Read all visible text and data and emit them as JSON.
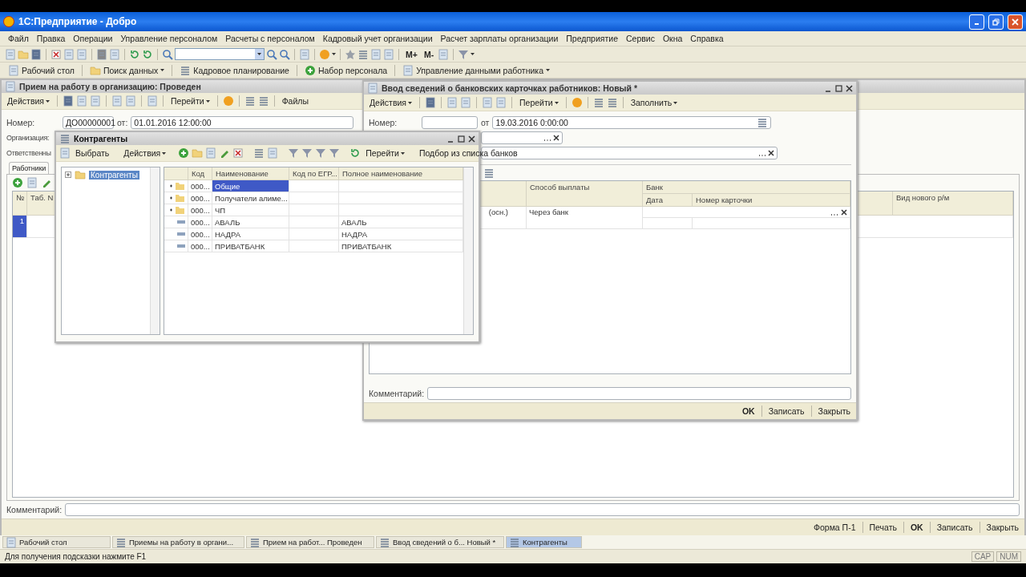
{
  "app": {
    "title": "1С:Предприятие - Добро"
  },
  "menu": [
    "Файл",
    "Правка",
    "Операции",
    "Управление персоналом",
    "Расчеты с персоналом",
    "Кадровый учет организации",
    "Расчет зарплаты организации",
    "Предприятие",
    "Сервис",
    "Окна",
    "Справка"
  ],
  "memory_buttons": [
    "M+",
    "M-"
  ],
  "quick_panel": [
    {
      "label": "Рабочий стол",
      "dropdown": false
    },
    {
      "label": "Поиск данных",
      "dropdown": true
    },
    {
      "label": "Кадровое планирование",
      "dropdown": false
    },
    {
      "label": "Набор персонала",
      "dropdown": false
    },
    {
      "label": "Управление данными работника",
      "dropdown": true
    }
  ],
  "hire_doc": {
    "title": "Прием на работу в организацию: Проведен",
    "toolbar": [
      {
        "label": "Действия",
        "dropdown": true
      },
      {
        "label": "Перейти",
        "dropdown": true
      },
      {
        "label": "Файлы",
        "dropdown": false
      }
    ],
    "number_label": "Номер:",
    "number": "ДО00000001",
    "date_label": "от:",
    "date": "01.01.2016 12:00:00",
    "labels": [
      "Организация:",
      "Ответственны"
    ],
    "tab": {
      "label": "Работники",
      "selected": true
    },
    "columns": [
      "№",
      "Таб. N"
    ],
    "last_column": "Вид нового р/м",
    "rows": [
      {
        "number": "1",
        "selected": true
      }
    ],
    "comment_label": "Комментарий:",
    "buttons": [
      {
        "label": "Форма П-1",
        "bold": false
      },
      {
        "label": "Печать",
        "bold": false
      },
      {
        "label": "OK",
        "bold": true
      },
      {
        "label": "Записать",
        "bold": false
      },
      {
        "label": "Закрыть",
        "bold": false
      }
    ]
  },
  "bank_cards": {
    "title": "Ввод сведений о банковских карточках работников: Новый *",
    "toolbar": [
      {
        "label": "Действия",
        "dropdown": true
      },
      {
        "label": "Перейти",
        "dropdown": true
      },
      {
        "label": "Заполнить",
        "dropdown": true
      }
    ],
    "number_label": "Номер:",
    "date_label": "от",
    "date": "19.03.2016  0:00:00",
    "payment_header": "Способ выплаты",
    "bank_header": "Банк",
    "date_header": "Дата",
    "card_header": "Номер карточки",
    "rows": [
      {
        "partial_text": "(осн.)",
        "payment_method": "Через банк"
      }
    ],
    "comment_label": "Комментарий:",
    "buttons": [
      {
        "label": "OK",
        "bold": true
      },
      {
        "label": "Записать",
        "bold": false
      },
      {
        "label": "Закрыть",
        "bold": false
      }
    ]
  },
  "counterparties": {
    "title": "Контрагенты",
    "toolbar": [
      {
        "label": "Выбрать",
        "dropdown": false
      },
      {
        "label": "Действия",
        "dropdown": true
      },
      {
        "label": "Перейти",
        "dropdown": true
      },
      {
        "label": "Подбор из списка банков",
        "dropdown": false
      }
    ],
    "tree": [
      {
        "label": "Контрагенты",
        "selected": true,
        "expanded": false
      }
    ],
    "columns": [
      "Код",
      "Наименование",
      "Код по ЕГР...",
      "Полное наименование"
    ],
    "rows": [
      {
        "kind": "group",
        "code": "000...",
        "name": "Общие",
        "selected": true
      },
      {
        "kind": "group",
        "code": "000...",
        "name": "Получатели алиме...",
        "selected": false
      },
      {
        "kind": "group",
        "code": "000...",
        "name": "ЧП",
        "selected": false
      },
      {
        "kind": "item",
        "code": "000...",
        "name": "АВАЛЬ",
        "full_name": "АВАЛЬ",
        "selected": false
      },
      {
        "kind": "item",
        "code": "000...",
        "name": "НАДРА",
        "full_name": "НАДРА",
        "selected": false
      },
      {
        "kind": "item",
        "code": "000...",
        "name": "ПРИВАТБАНК",
        "full_name": "ПРИВАТБАНК",
        "selected": false
      }
    ]
  },
  "taskbar": [
    {
      "label": "Рабочий стол",
      "selected": false
    },
    {
      "label": "Приемы на работу в органи...",
      "selected": false
    },
    {
      "label": "Прием на работ... Проведен",
      "selected": false
    },
    {
      "label": "Ввод сведений о б... Новый *",
      "selected": false
    },
    {
      "label": "Контрагенты",
      "selected": true
    }
  ],
  "status_bar": {
    "hint": "Для получения подсказки нажмите F1",
    "indicators": [
      "CAP",
      "NUM"
    ]
  }
}
